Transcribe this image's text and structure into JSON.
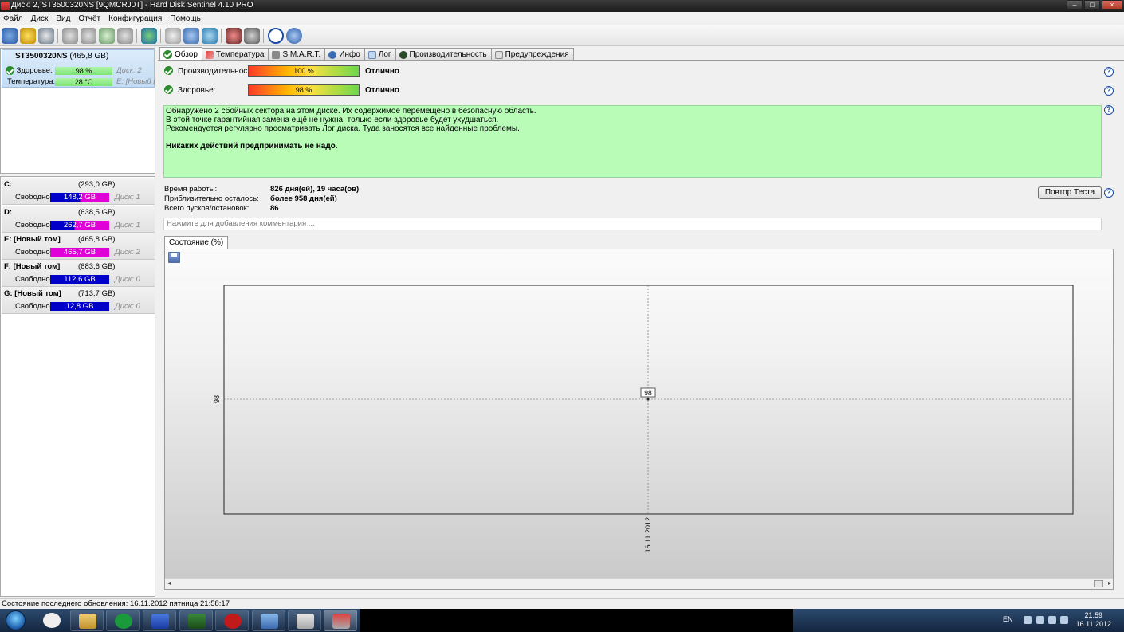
{
  "window": {
    "title": "Диск: 2, ST3500320NS [9QMCRJ0T]  -  Hard Disk Sentinel 4.10 PRO"
  },
  "menu": [
    "Файл",
    "Диск",
    "Вид",
    "Отчёт",
    "Конфигурация",
    "Помощь"
  ],
  "disk": {
    "name": "ST3500320NS",
    "size": "(465,8 GB)",
    "health_label": "Здоровье:",
    "health_value": "98 %",
    "health_disk": "Диск: 2",
    "temp_label": "Температура:",
    "temp_value": "28 °C",
    "temp_volume": "E: [Новый то"
  },
  "volumes": [
    {
      "name": "C:",
      "size": "(293,0 GB)",
      "free_label": "Свободно",
      "free": "148,2 GB",
      "free_fraction": 0.51,
      "disk": "Диск: 1"
    },
    {
      "name": "D:",
      "size": "(638,5 GB)",
      "free_label": "Свободно",
      "free": "262,7 GB",
      "free_fraction": 0.41,
      "disk": "Диск: 1"
    },
    {
      "name": "E: [Новый том]",
      "size": "(465,8 GB)",
      "free_label": "Свободно",
      "free": "465,7 GB",
      "free_fraction": 0.0,
      "disk": "Диск: 2"
    },
    {
      "name": "F: [Новый том]",
      "size": "(683,6 GB)",
      "free_label": "Свободно",
      "free": "112,6 GB",
      "free_fraction": 0.16,
      "disk": "Диск: 0"
    },
    {
      "name": "G: [Новый том]",
      "size": "(713,7 GB)",
      "free_label": "Свободно",
      "free": "12,8 GB",
      "free_fraction": 0.02,
      "disk": "Диск: 0"
    }
  ],
  "tabs": [
    "Обзор",
    "Температура",
    "S.M.A.R.T.",
    "Инфо",
    "Лог",
    "Производительность",
    "Предупреждения"
  ],
  "overview": {
    "performance_label": "Производительность:",
    "performance_value": "100 %",
    "performance_status": "Отлично",
    "health_label": "Здоровье:",
    "health_value": "98 %",
    "health_status": "Отлично",
    "message_lines": [
      "Обнаружено 2 сбойных сектора на этом диске. Их содержимое перемещено в безопасную область.",
      "В этой точке гарантийная замена ещё не нужна, только если здоровье будет ухудшаться.",
      "Рекомендуется регулярно просматривать Лог диска. Туда заносятся все найденные проблемы."
    ],
    "message_bold": "Никаких действий предпринимать не надо.",
    "info": [
      {
        "key": "Время работы:",
        "value": "826 дня(ей), 19 часа(ов)"
      },
      {
        "key": "Приблизительно осталось:",
        "value": "более 958 дня(ей)"
      },
      {
        "key": "Всего пусков/остановок:",
        "value": "86"
      }
    ],
    "retest_button": "Повтор Теста",
    "comment_placeholder": "Нажмите для добавления комментария ...",
    "chart_tab": "Состояние (%)"
  },
  "chart_data": {
    "type": "line",
    "x": [
      "16.11.2012"
    ],
    "values": [
      98
    ],
    "point_label": "98",
    "y_tick_labels": [
      "98"
    ],
    "x_tick_labels": [
      "16.11.2012"
    ],
    "grid": true
  },
  "status": {
    "text": "Состояние последнего обновления: 16.11.2012 пятница 21:58:17"
  },
  "taskbar": {
    "lang": "EN",
    "time": "21:59",
    "date": "16.11.2012"
  }
}
